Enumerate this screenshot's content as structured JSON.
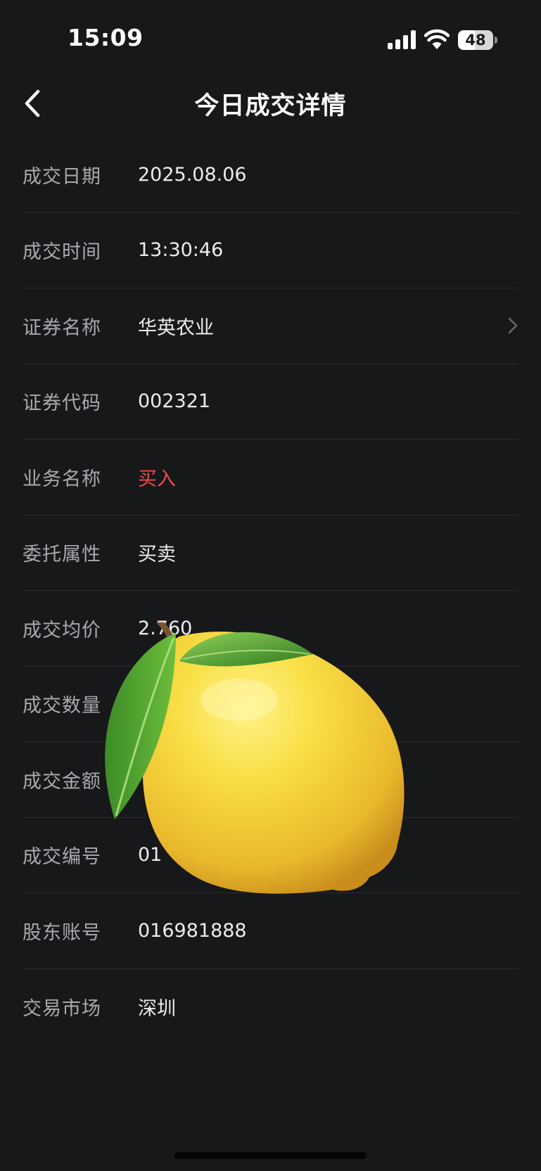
{
  "status_bar": {
    "time": "15:09",
    "battery_percent": "48",
    "battery_level": 0.48,
    "icons": [
      "signal-icon",
      "wifi-icon",
      "battery-icon"
    ]
  },
  "nav": {
    "title": "今日成交详情",
    "back_icon": "chevron-left-icon"
  },
  "details": [
    {
      "label": "成交日期",
      "value": "2025.08.06"
    },
    {
      "label": "成交时间",
      "value": "13:30:46"
    },
    {
      "label": "证券名称",
      "value": "华英农业"
    },
    {
      "label": "证券代码",
      "value": "002321"
    },
    {
      "label": "业务名称",
      "value": "买入"
    },
    {
      "label": "委托属性",
      "value": "买卖"
    },
    {
      "label": "成交均价",
      "value": "2.760"
    },
    {
      "label": "成交数量",
      "value": ""
    },
    {
      "label": "成交金额",
      "value": ""
    },
    {
      "label": "成交编号",
      "value": "01"
    },
    {
      "label": "股东账号",
      "value": "016981888"
    },
    {
      "label": "交易市场",
      "value": "深圳"
    }
  ],
  "colors": {
    "background": "#17181a",
    "label": "#a9aaae",
    "value": "#ececee",
    "buy": "#ef4b4b",
    "divider": "#2a2b2e"
  },
  "overlay": {
    "icon": "lemon-sticker"
  }
}
